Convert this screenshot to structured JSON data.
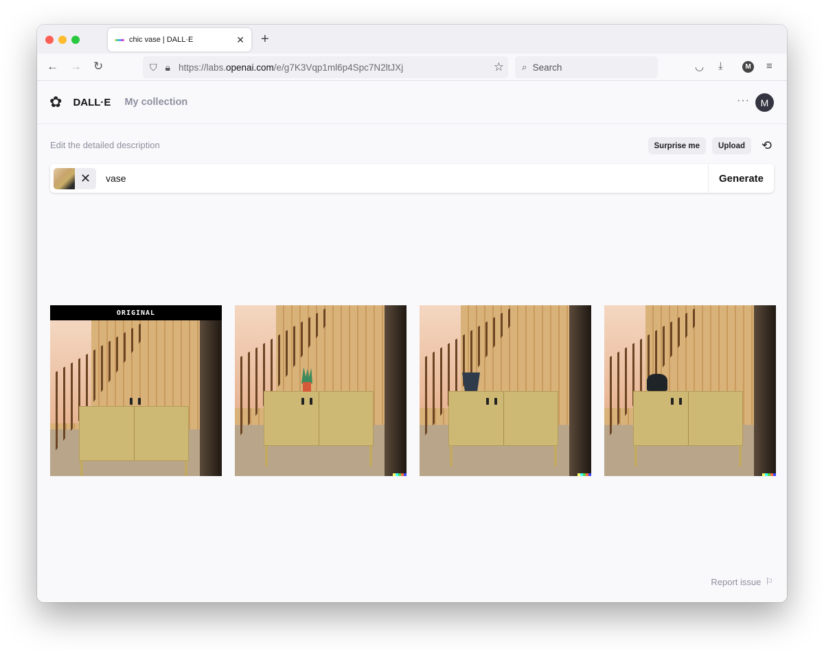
{
  "browser": {
    "tab": {
      "title": "chic vase | DALL·E"
    },
    "url": {
      "prefix": "https://labs.",
      "domain": "openai.com",
      "path": "/e/g7K3Vqp1ml6p4Spc7N2ltJXj"
    },
    "search": {
      "placeholder": "Search"
    },
    "account_initial": "M"
  },
  "app": {
    "brand": "DALL·E",
    "nav": {
      "my_collection": "My collection"
    },
    "more_label": "···",
    "avatar_initial": "M"
  },
  "editor": {
    "label": "Edit the detailed description",
    "surprise_label": "Surprise me",
    "upload_label": "Upload",
    "prompt_value": "vase",
    "generate_label": "Generate"
  },
  "results": {
    "original_label": "ORIGINAL",
    "images": [
      {
        "kind": "original",
        "object": "none"
      },
      {
        "kind": "generated",
        "object": "potted plant"
      },
      {
        "kind": "generated",
        "object": "dark vase"
      },
      {
        "kind": "generated",
        "object": "dark sculpture"
      }
    ],
    "signature_colors": [
      "#ffff66",
      "#42ffff",
      "#51da4c",
      "#ff6e3c",
      "#3c46ff"
    ]
  },
  "footer": {
    "report_label": "Report issue"
  }
}
